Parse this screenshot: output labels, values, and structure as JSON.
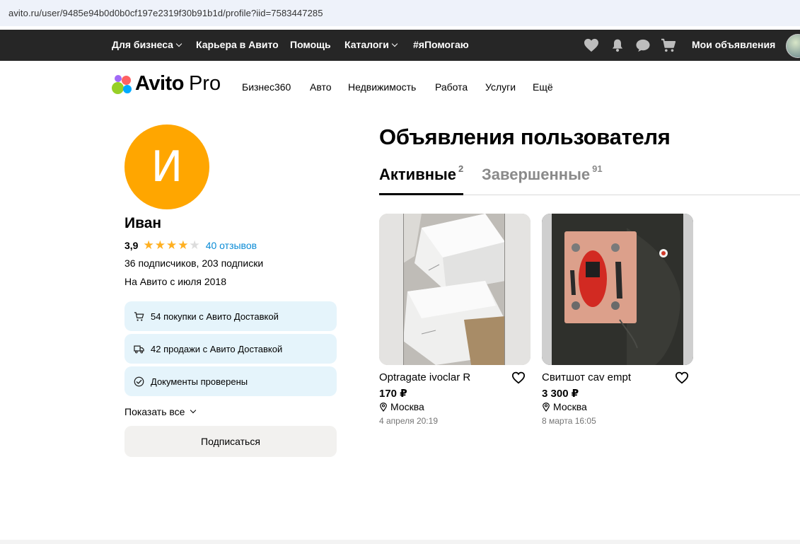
{
  "browser": {
    "url": "avito.ru/user/9485e94b0d0b0cf197e2319f30b91b1d/profile?iid=7583447285"
  },
  "topbar": {
    "items": [
      {
        "label": "Для бизнеса",
        "dropdown": true
      },
      {
        "label": "Карьера в Авито",
        "dropdown": false
      },
      {
        "label": "Помощь",
        "dropdown": false
      },
      {
        "label": "Каталоги",
        "dropdown": true
      },
      {
        "label": "#яПомогаю",
        "dropdown": false
      }
    ],
    "icons": [
      "heart-icon",
      "bell-icon",
      "chat-icon",
      "cart-icon"
    ],
    "my_ads": "Мои объявления"
  },
  "logo": {
    "brand": "Avito",
    "suffix": "Pro",
    "dot_colors": [
      "#97cf26",
      "#a169f7",
      "#ff6163",
      "#00aaff"
    ]
  },
  "catnav": {
    "items": [
      "Бизнес360",
      "Авто",
      "Недвижимость",
      "Работа",
      "Услуги",
      "Ещё"
    ]
  },
  "profile": {
    "avatar_letter": "И",
    "avatar_color": "#ffa600",
    "name": "Иван",
    "rating": "3,9",
    "stars_filled": 4,
    "stars_total": 5,
    "reviews": "40 отзывов",
    "subscribers": "36 подписчиков, 203 подписки",
    "since": "На Авито с июля 2018",
    "badges": [
      {
        "icon": "cart-icon",
        "text": "54 покупки с Авито Доставкой"
      },
      {
        "icon": "truck-icon",
        "text": "42 продажи с Авито Доставкой"
      },
      {
        "icon": "check-circle-icon",
        "text": "Документы проверены"
      }
    ],
    "show_all": "Показать все",
    "subscribe": "Подписаться"
  },
  "listings": {
    "title": "Объявления пользователя",
    "tabs": [
      {
        "label": "Активные",
        "count": "2",
        "active": true
      },
      {
        "label": "Завершенные",
        "count": "91",
        "active": false
      }
    ],
    "items": [
      {
        "title": "Optragate ivoclar R",
        "price": "170 ₽",
        "location": "Москва",
        "date": "4 апреля 20:19"
      },
      {
        "title": "Свитшот cav empt",
        "price": "3 300 ₽",
        "location": "Москва",
        "date": "8 марта 16:05"
      }
    ]
  },
  "colors": {
    "accent_link": "#0a8bd6",
    "star": "#ffb021",
    "badge_bg": "#e5f4fb"
  }
}
